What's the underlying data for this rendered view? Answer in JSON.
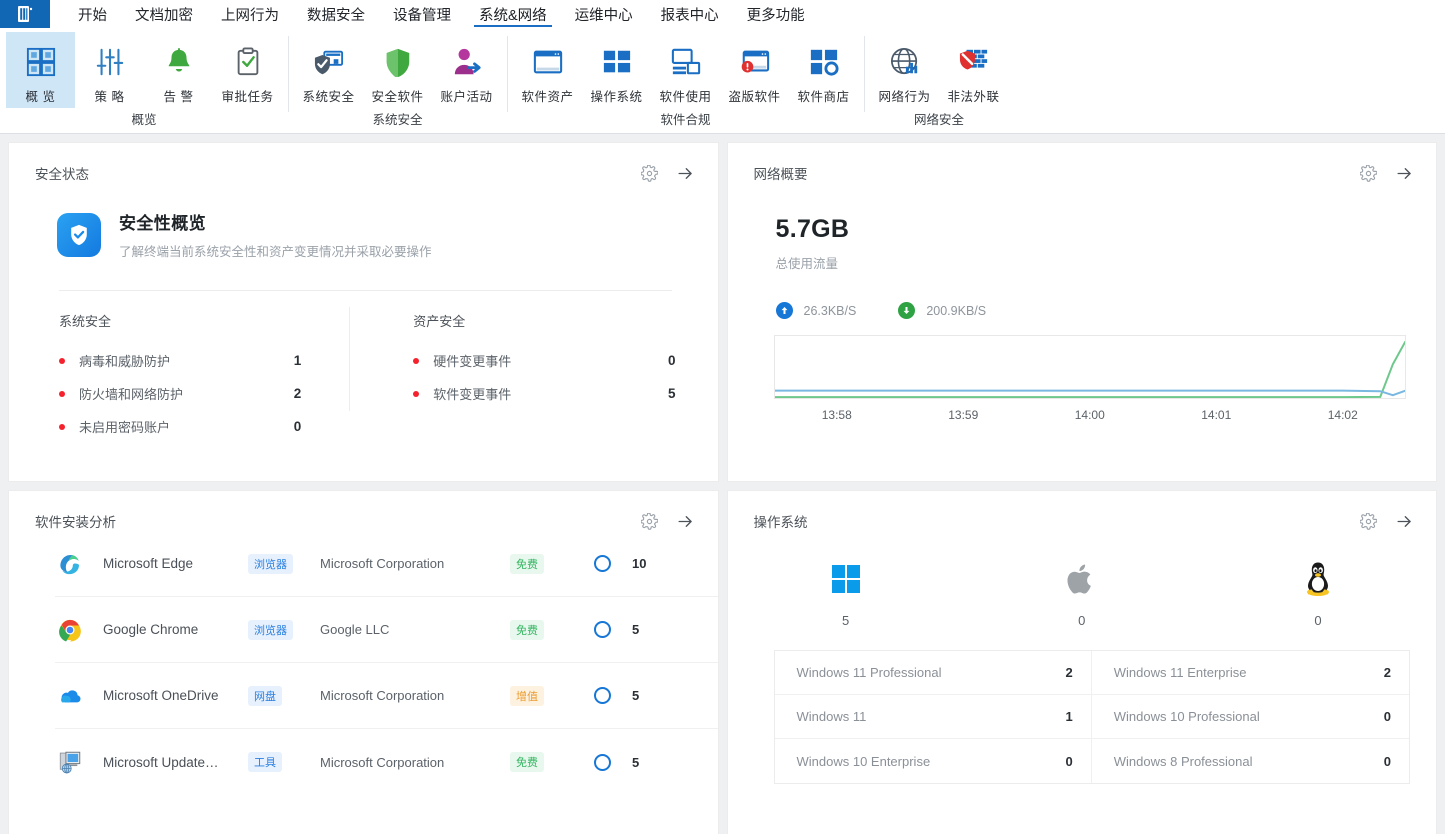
{
  "app": {
    "logo_icon": "document-list-icon"
  },
  "menubar": {
    "tabs": [
      {
        "label": "开始",
        "active": false
      },
      {
        "label": "文档加密",
        "active": false
      },
      {
        "label": "上网行为",
        "active": false
      },
      {
        "label": "数据安全",
        "active": false
      },
      {
        "label": "设备管理",
        "active": false
      },
      {
        "label": "系统&网络",
        "active": true
      },
      {
        "label": "运维中心",
        "active": false
      },
      {
        "label": "报表中心",
        "active": false
      },
      {
        "label": "更多功能",
        "active": false
      }
    ]
  },
  "ribbon": {
    "groups": [
      {
        "label": "概览",
        "items": [
          {
            "label": "概 览",
            "icon": "grid-overview-icon",
            "selected": true
          },
          {
            "label": "策 略",
            "icon": "sliders-policy-icon",
            "selected": false
          },
          {
            "label": "告 警",
            "icon": "bell-alert-icon",
            "selected": false
          },
          {
            "label": "审批任务",
            "icon": "clipboard-check-icon",
            "selected": false
          }
        ]
      },
      {
        "label": "系统安全",
        "items": [
          {
            "label": "系统安全",
            "icon": "shield-monitor-icon",
            "selected": false
          },
          {
            "label": "安全软件",
            "icon": "shield-green-icon",
            "selected": false
          },
          {
            "label": "账户活动",
            "icon": "user-activity-icon",
            "selected": false
          }
        ]
      },
      {
        "label": "软件合规",
        "items": [
          {
            "label": "软件资产",
            "icon": "window-asset-icon",
            "selected": false
          },
          {
            "label": "操作系统",
            "icon": "windows-tiles-icon",
            "selected": false
          },
          {
            "label": "软件使用",
            "icon": "monitor-usage-icon",
            "selected": false
          },
          {
            "label": "盗版软件",
            "icon": "window-warning-icon",
            "selected": false
          },
          {
            "label": "软件商店",
            "icon": "store-tiles-icon",
            "selected": false
          }
        ]
      },
      {
        "label": "网络安全",
        "items": [
          {
            "label": "网络行为",
            "icon": "globe-chart-icon",
            "selected": false
          },
          {
            "label": "非法外联",
            "icon": "firewall-block-icon",
            "selected": false
          }
        ]
      }
    ]
  },
  "cards": {
    "security": {
      "title": "安全状态",
      "gear_icon": "gear-icon",
      "arrow_icon": "arrow-right-icon",
      "hero": {
        "icon": "shield-check-icon",
        "heading": "安全性概览",
        "subtext": "了解终端当前系统安全性和资产变更情况并采取必要操作"
      },
      "columns": [
        {
          "heading": "系统安全",
          "rows": [
            {
              "label": "病毒和威胁防护",
              "value": "1"
            },
            {
              "label": "防火墙和网络防护",
              "value": "2"
            },
            {
              "label": "未启用密码账户",
              "value": "0"
            }
          ]
        },
        {
          "heading": "资产安全",
          "rows": [
            {
              "label": "硬件变更事件",
              "value": "0"
            },
            {
              "label": "软件变更事件",
              "value": "5"
            }
          ]
        }
      ],
      "dot_color": "#f5222d"
    },
    "network": {
      "title": "网络概要",
      "gear_icon": "gear-icon",
      "arrow_icon": "arrow-right-icon",
      "total": "5.7GB",
      "total_label": "总使用流量",
      "upload": {
        "icon": "arrow-up-circle-icon",
        "value": "26.3KB/S",
        "color": "#1677d6"
      },
      "download": {
        "icon": "arrow-down-circle-icon",
        "value": "200.9KB/S",
        "color": "#2fa244"
      },
      "chart_data": {
        "type": "line",
        "title": "",
        "xlabel": "",
        "ylabel": "",
        "grid": false,
        "legend": "none",
        "x_ticks": [
          "13:58",
          "13:59",
          "14:00",
          "14:01",
          "14:02"
        ],
        "xlim": [
          0,
          100
        ],
        "ylim": [
          0,
          220
        ],
        "series": [
          {
            "name": "下载",
            "color": "#6dc88b",
            "x": [
              0,
              10,
              20,
              30,
              40,
              50,
              60,
              70,
              80,
              90,
              96,
              98,
              100
            ],
            "values": [
              3,
              3,
              3,
              3,
              3,
              3,
              3,
              3,
              3,
              3,
              4,
              120,
              201
            ]
          },
          {
            "name": "上传",
            "color": "#79b8e0",
            "x": [
              0,
              10,
              20,
              30,
              40,
              50,
              60,
              70,
              80,
              90,
              96,
              98,
              100
            ],
            "values": [
              26,
              26,
              26,
              26,
              26,
              26,
              26,
              26,
              26,
              26,
              24,
              10,
              26
            ]
          }
        ]
      }
    },
    "software": {
      "title": "软件安装分析",
      "gear_icon": "gear-icon",
      "arrow_icon": "arrow-right-icon",
      "rows": [
        {
          "icon": "edge-icon",
          "name": "Microsoft Edge",
          "tag": "浏览器",
          "tag_style": "blue",
          "vendor": "Microsoft Corporation",
          "license": "免费",
          "license_style": "green",
          "ring": "ring-icon",
          "count": "10"
        },
        {
          "icon": "chrome-icon",
          "name": "Google Chrome",
          "tag": "浏览器",
          "tag_style": "blue",
          "vendor": "Google LLC",
          "license": "免费",
          "license_style": "green",
          "ring": "ring-icon",
          "count": "5"
        },
        {
          "icon": "onedrive-icon",
          "name": "Microsoft OneDrive",
          "tag": "网盘",
          "tag_style": "blue",
          "vendor": "Microsoft Corporation",
          "license": "增值",
          "license_style": "orange",
          "ring": "ring-icon",
          "count": "5"
        },
        {
          "icon": "update-icon",
          "name": "Microsoft Update…",
          "tag": "工具",
          "tag_style": "blue",
          "vendor": "Microsoft Corporation",
          "license": "免费",
          "license_style": "green",
          "ring": "ring-icon",
          "count": "5"
        }
      ]
    },
    "os": {
      "title": "操作系统",
      "gear_icon": "gear-icon",
      "arrow_icon": "arrow-right-icon",
      "tiles": [
        {
          "icon": "windows-icon",
          "count": "5"
        },
        {
          "icon": "apple-icon",
          "count": "0"
        },
        {
          "icon": "linux-penguin-icon",
          "count": "0"
        }
      ],
      "table": [
        {
          "label": "Windows 11 Professional",
          "value": "2"
        },
        {
          "label": "Windows 11 Enterprise",
          "value": "2"
        },
        {
          "label": "Windows 11",
          "value": "1"
        },
        {
          "label": "Windows 10 Professional",
          "value": "0"
        },
        {
          "label": "Windows 10 Enterprise",
          "value": "0"
        },
        {
          "label": "Windows 8 Professional",
          "value": "0"
        }
      ]
    }
  }
}
